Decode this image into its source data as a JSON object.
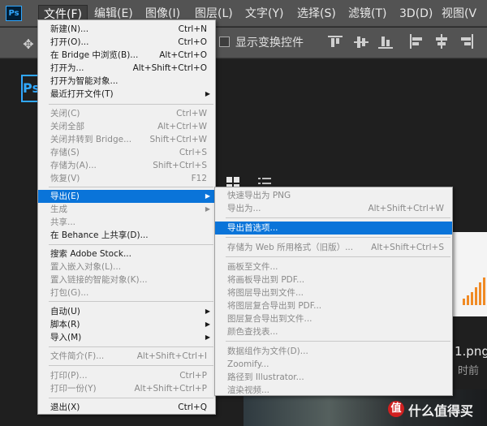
{
  "app": {
    "logo": "Ps"
  },
  "menubar": {
    "items": [
      {
        "label": "文件(F)",
        "active": true
      },
      {
        "label": "编辑(E)"
      },
      {
        "label": "图像(I)"
      },
      {
        "label": "图层(L)"
      },
      {
        "label": "文字(Y)"
      },
      {
        "label": "选择(S)"
      },
      {
        "label": "滤镜(T)"
      },
      {
        "label": "3D(D)"
      },
      {
        "label": "视图(V"
      }
    ]
  },
  "options_bar": {
    "move_icon": "move-tool-icon",
    "show_transform_label": "显示变换控件",
    "show_transform_checked": false
  },
  "home": {
    "logo": "Ps",
    "view_icons": [
      "grid-view-icon",
      "list-view-icon"
    ],
    "file_name": "1.png",
    "file_time": "时前",
    "watermark": {
      "icon": "值",
      "text": "什么值得买"
    }
  },
  "file_menu": {
    "items": [
      {
        "label": "新建(N)...",
        "shortcut": "Ctrl+N",
        "enabled": true
      },
      {
        "label": "打开(O)...",
        "shortcut": "Ctrl+O",
        "enabled": true
      },
      {
        "label": "在 Bridge 中浏览(B)...",
        "shortcut": "Alt+Ctrl+O",
        "enabled": true
      },
      {
        "label": "打开为...",
        "shortcut": "Alt+Shift+Ctrl+O",
        "enabled": true
      },
      {
        "label": "打开为智能对象...",
        "shortcut": "",
        "enabled": true
      },
      {
        "label": "最近打开文件(T)",
        "shortcut": "",
        "enabled": true,
        "submenu": true
      },
      {
        "label": "关闭(C)",
        "shortcut": "Ctrl+W",
        "enabled": false
      },
      {
        "label": "关闭全部",
        "shortcut": "Alt+Ctrl+W",
        "enabled": false
      },
      {
        "label": "关闭并转到 Bridge...",
        "shortcut": "Shift+Ctrl+W",
        "enabled": false
      },
      {
        "label": "存储(S)",
        "shortcut": "Ctrl+S",
        "enabled": false
      },
      {
        "label": "存储为(A)...",
        "shortcut": "Shift+Ctrl+S",
        "enabled": false
      },
      {
        "label": "恢复(V)",
        "shortcut": "F12",
        "enabled": false
      },
      {
        "label": "导出(E)",
        "shortcut": "",
        "enabled": true,
        "submenu": true,
        "highlighted": true
      },
      {
        "label": "生成",
        "shortcut": "",
        "enabled": false,
        "submenu": true
      },
      {
        "label": "共享...",
        "shortcut": "",
        "enabled": false
      },
      {
        "label": "在 Behance 上共享(D)...",
        "shortcut": "",
        "enabled": true
      },
      {
        "label": "搜索 Adobe Stock...",
        "shortcut": "",
        "enabled": true
      },
      {
        "label": "置入嵌入对象(L)...",
        "shortcut": "",
        "enabled": false
      },
      {
        "label": "置入链接的智能对象(K)...",
        "shortcut": "",
        "enabled": false
      },
      {
        "label": "打包(G)...",
        "shortcut": "",
        "enabled": false
      },
      {
        "label": "自动(U)",
        "shortcut": "",
        "enabled": true,
        "submenu": true
      },
      {
        "label": "脚本(R)",
        "shortcut": "",
        "enabled": true,
        "submenu": true
      },
      {
        "label": "导入(M)",
        "shortcut": "",
        "enabled": true,
        "submenu": true
      },
      {
        "label": "文件简介(F)...",
        "shortcut": "Alt+Shift+Ctrl+I",
        "enabled": false
      },
      {
        "label": "打印(P)...",
        "shortcut": "Ctrl+P",
        "enabled": false
      },
      {
        "label": "打印一份(Y)",
        "shortcut": "Alt+Shift+Ctrl+P",
        "enabled": false
      },
      {
        "label": "退出(X)",
        "shortcut": "Ctrl+Q",
        "enabled": true
      }
    ]
  },
  "export_menu": {
    "items": [
      {
        "label": "快速导出为 PNG",
        "shortcut": "",
        "enabled": false
      },
      {
        "label": "导出为...",
        "shortcut": "Alt+Shift+Ctrl+W",
        "enabled": false
      },
      {
        "label": "导出首选项...",
        "shortcut": "",
        "enabled": true,
        "highlighted": true
      },
      {
        "label": "存储为 Web 所用格式（旧版）...",
        "shortcut": "Alt+Shift+Ctrl+S",
        "enabled": false
      },
      {
        "label": "画板至文件...",
        "shortcut": "",
        "enabled": false
      },
      {
        "label": "将画板导出到 PDF...",
        "shortcut": "",
        "enabled": false
      },
      {
        "label": "将图层导出到文件...",
        "shortcut": "",
        "enabled": false
      },
      {
        "label": "将图层复合导出到 PDF...",
        "shortcut": "",
        "enabled": false
      },
      {
        "label": "图层复合导出到文件...",
        "shortcut": "",
        "enabled": false
      },
      {
        "label": "颜色查找表...",
        "shortcut": "",
        "enabled": false
      },
      {
        "label": "数据组作为文件(D)...",
        "shortcut": "",
        "enabled": false
      },
      {
        "label": "Zoomify...",
        "shortcut": "",
        "enabled": false
      },
      {
        "label": "路径到 Illustrator...",
        "shortcut": "",
        "enabled": false
      },
      {
        "label": "渲染视频...",
        "shortcut": "",
        "enabled": false
      }
    ]
  },
  "colors": {
    "highlight": "#0a74d9",
    "menu_bg": "#f0f0f0",
    "chrome": "#535353",
    "brand": "#31a8ff"
  }
}
